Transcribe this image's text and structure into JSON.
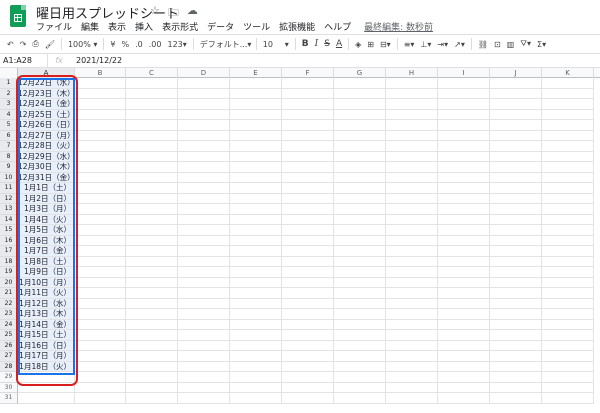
{
  "title": "曜日用スプレッドシート",
  "title_icons": [
    "star-icon",
    "folder-move-icon",
    "cloud-icon"
  ],
  "menu": [
    "ファイル",
    "編集",
    "表示",
    "挿入",
    "表示形式",
    "データ",
    "ツール",
    "拡張機能",
    "ヘルプ"
  ],
  "last_edit": "最終編集: 数秒前",
  "toolbar": {
    "zoom": "100%",
    "currency": "¥",
    "percent": "%",
    "dec_decrease": ".0",
    "dec_increase": ".00",
    "more_formats": "123",
    "font": "デフォルト...",
    "font_size": "10",
    "bold": "B",
    "italic": "I",
    "strike": "S",
    "text_color": "A",
    "sum": "Σ"
  },
  "formula_bar": {
    "name_box": "A1:A28",
    "fx": "fx",
    "value": "2021/12/22"
  },
  "columns": [
    "A",
    "B",
    "C",
    "D",
    "E",
    "F",
    "G",
    "H",
    "I",
    "J",
    "K"
  ],
  "row_numbers": [
    "1",
    "2",
    "3",
    "4",
    "5",
    "6",
    "7",
    "8",
    "9",
    "10",
    "11",
    "12",
    "13",
    "14",
    "15",
    "16",
    "17",
    "18",
    "19",
    "20",
    "21",
    "22",
    "23",
    "24",
    "25",
    "26",
    "27",
    "28",
    "29",
    "30",
    "31"
  ],
  "column_a": [
    "12月22日（水）",
    "12月23日（木）",
    "12月24日（金）",
    "12月25日（土）",
    "12月26日（日）",
    "12月27日（月）",
    "12月28日（火）",
    "12月29日（水）",
    "12月30日（木）",
    "12月31日（金）",
    "1月1日（土）",
    "1月2日（日）",
    "1月3日（月）",
    "1月4日（火）",
    "1月5日（水）",
    "1月6日（木）",
    "1月7日（金）",
    "1月8日（土）",
    "1月9日（日）",
    "1月10日（月）",
    "1月11日（火）",
    "1月12日（水）",
    "1月13日（木）",
    "1月14日（金）",
    "1月15日（土）",
    "1月16日（日）",
    "1月17日（月）",
    "1月18日（火）"
  ],
  "colors": {
    "accent": "#1a73e8",
    "annotation": "#d81e1e",
    "selection_fill": "#e8f0fe",
    "logo": "#0f9d58"
  }
}
